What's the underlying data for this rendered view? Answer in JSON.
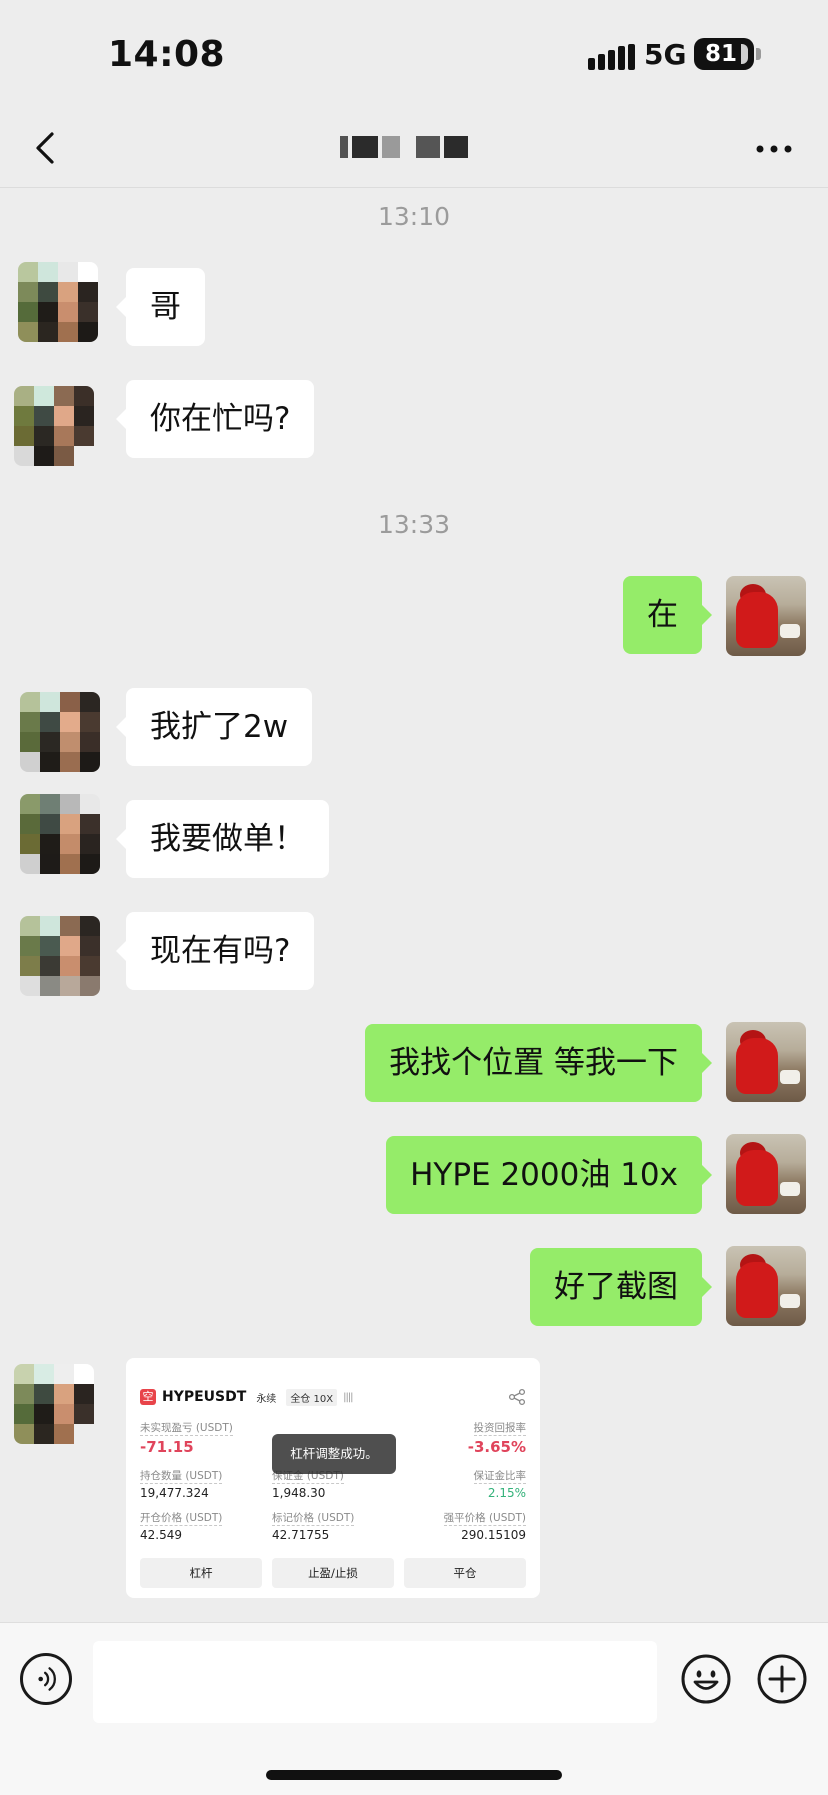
{
  "status_bar": {
    "time": "14:08",
    "network": "5G",
    "battery": "81"
  },
  "header": {
    "back_icon": "chevron-left-icon",
    "more_icon": "more-dots-icon"
  },
  "timestamps": [
    "13:10",
    "13:33"
  ],
  "messages": [
    {
      "side": "left",
      "text": "哥"
    },
    {
      "side": "left",
      "text": "你在忙吗?"
    },
    {
      "side": "right",
      "text": "在"
    },
    {
      "side": "left",
      "text": "我扩了2w"
    },
    {
      "side": "left",
      "text": "我要做单！"
    },
    {
      "side": "left",
      "text": "现在有吗?"
    },
    {
      "side": "right",
      "text": "我找个位置 等我一下"
    },
    {
      "side": "right",
      "text": "HYPE 2000油 10x"
    },
    {
      "side": "right",
      "text": "好了截图"
    }
  ],
  "screenshot": {
    "pair": "HYPEUSDT",
    "tag1": "永续",
    "tag2": "全仓 10X",
    "unrealized_label": "未实现盈亏 (USDT)",
    "unrealized_value": "-71.15",
    "roi_label": "投资回报率",
    "roi_value": "-3.65%",
    "qty_label": "持仓数量 (USDT)",
    "qty_value": "19,477.324",
    "margin_label": "保证金 (USDT)",
    "margin_value": "1,948.30",
    "margin_ratio_label": "保证金比率",
    "margin_ratio_value": "2.15%",
    "entry_label": "开仓价格 (USDT)",
    "entry_value": "42.549",
    "mark_label": "标记价格 (USDT)",
    "mark_value": "42.71755",
    "liq_label": "强平价格 (USDT)",
    "liq_value": "290.15109",
    "toast": "杠杆调整成功。",
    "btn_leverage": "杠杆",
    "btn_tpsl": "止盈/止损",
    "btn_close": "平仓"
  },
  "colors": {
    "bubble_mine": "#95ec69",
    "bubble_other": "#ffffff",
    "background": "#ededed",
    "negative": "#e0445b",
    "positive": "#34b27a"
  }
}
